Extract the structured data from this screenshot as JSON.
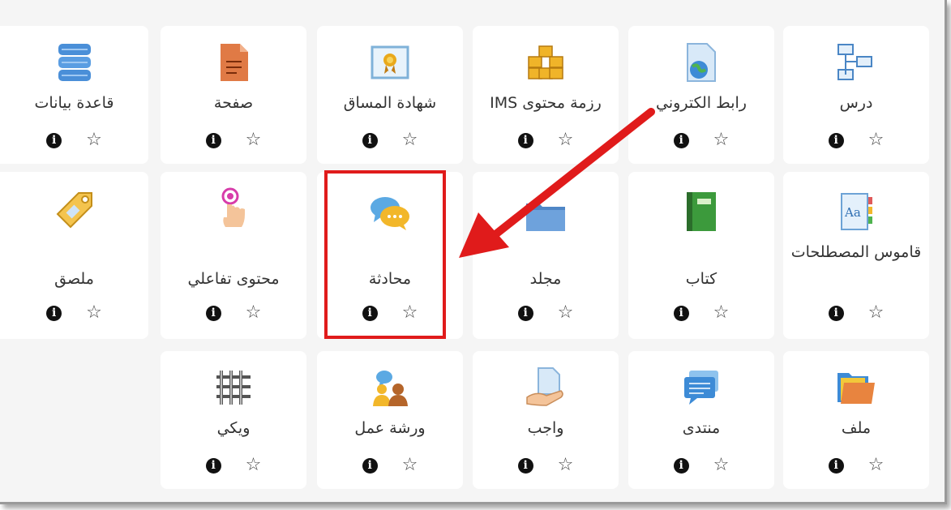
{
  "activities": [
    {
      "id": "database",
      "label": "قاعدة بيانات",
      "icon": "database-icon"
    },
    {
      "id": "page",
      "label": "صفحة",
      "icon": "page-icon"
    },
    {
      "id": "certificate",
      "label": "شهادة المساق",
      "icon": "certificate-icon"
    },
    {
      "id": "ims",
      "label": "رزمة محتوى IMS",
      "icon": "package-icon"
    },
    {
      "id": "url",
      "label": "رابط الكتروني",
      "icon": "url-icon"
    },
    {
      "id": "lesson",
      "label": "درس",
      "icon": "lesson-icon"
    },
    {
      "id": "label",
      "label": "ملصق",
      "icon": "tag-icon"
    },
    {
      "id": "h5p",
      "label": "محتوى تفاعلي",
      "icon": "touch-icon"
    },
    {
      "id": "chat",
      "label": "محادثة",
      "icon": "chat-icon"
    },
    {
      "id": "folder",
      "label": "مجلد",
      "icon": "folder-icon"
    },
    {
      "id": "book",
      "label": "كتاب",
      "icon": "book-icon"
    },
    {
      "id": "glossary",
      "label": "قاموس المصطلحات",
      "icon": "glossary-icon"
    },
    {
      "id": "wiki",
      "label": "ويكي",
      "icon": "wiki-icon"
    },
    {
      "id": "workshop",
      "label": "ورشة عمل",
      "icon": "workshop-icon"
    },
    {
      "id": "assign",
      "label": "واجب",
      "icon": "assignment-icon"
    },
    {
      "id": "forum",
      "label": "منتدى",
      "icon": "forum-icon"
    },
    {
      "id": "file",
      "label": "ملف",
      "icon": "file-icon"
    }
  ],
  "colors": {
    "highlight": "#e01b1b",
    "arrow": "#e01b1b"
  }
}
